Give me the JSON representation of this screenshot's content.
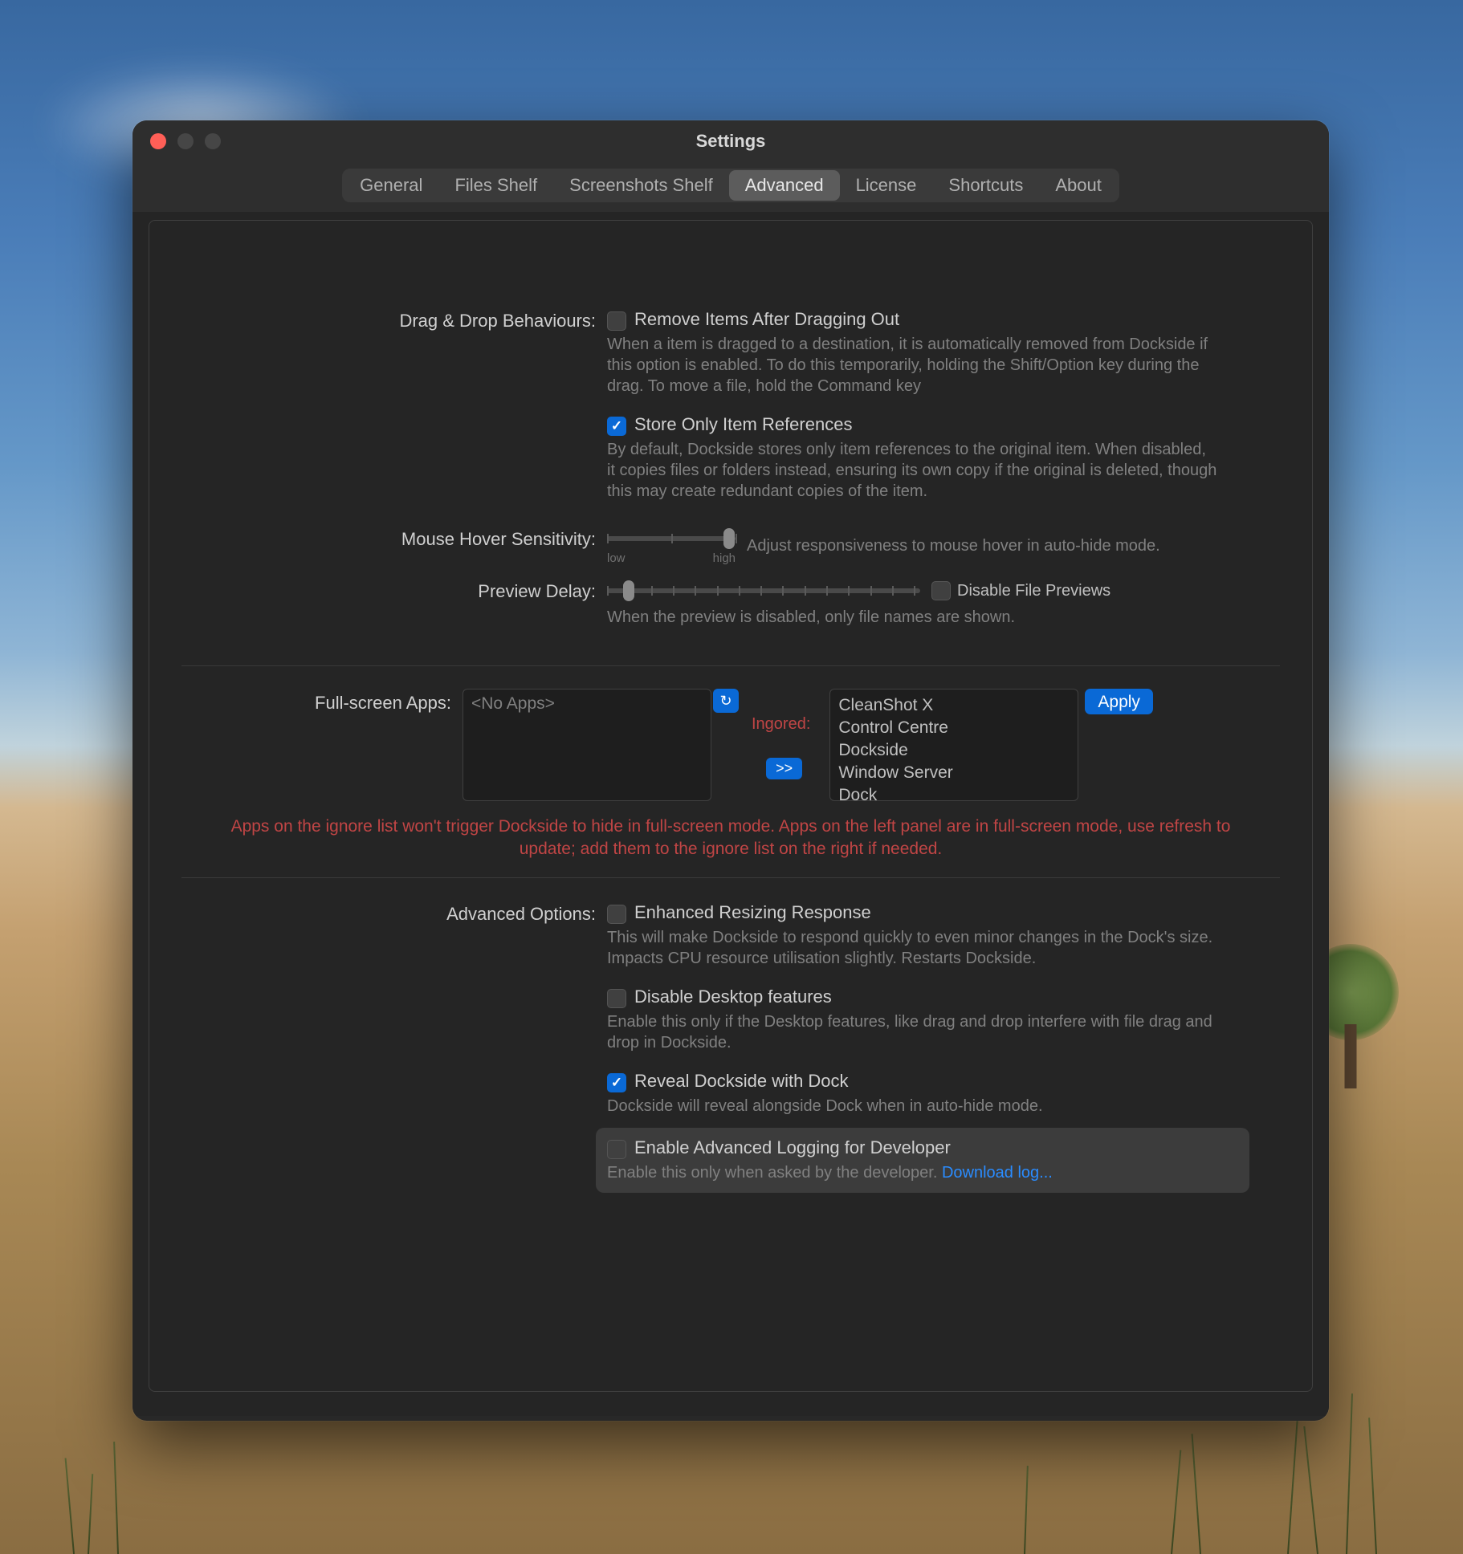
{
  "window": {
    "title": "Settings"
  },
  "tabs": {
    "general": "General",
    "files_shelf": "Files Shelf",
    "screenshots_shelf": "Screenshots Shelf",
    "advanced": "Advanced",
    "license": "License",
    "shortcuts": "Shortcuts",
    "about": "About"
  },
  "drag_drop": {
    "label": "Drag & Drop Behaviours:",
    "remove_items": {
      "label": "Remove Items After Dragging Out",
      "desc": "When a item is dragged to a destination, it is automatically removed from Dockside if this option is enabled. To do this temporarily, holding the Shift/Option key during the drag. To move a file, hold the Command key",
      "checked": false
    },
    "store_refs": {
      "label": "Store Only Item References",
      "desc": "By default, Dockside stores only item references to the original item. When disabled, it copies files or folders instead, ensuring its own copy if the original is deleted, though this may create redundant copies of the item.",
      "checked": true
    }
  },
  "hover": {
    "label": "Mouse Hover Sensitivity:",
    "desc": "Adjust responsiveness to mouse hover in auto-hide mode.",
    "low": "low",
    "high": "high"
  },
  "preview": {
    "label": "Preview Delay:",
    "disable_label": "Disable File Previews",
    "disable_checked": false,
    "desc": "When the preview is disabled, only file names are shown."
  },
  "fullscreen": {
    "label": "Full-screen Apps:",
    "no_apps": "<No Apps>",
    "ignored_label": "Ingored:",
    "ignored": [
      "CleanShot X",
      "Control Centre",
      "Dockside",
      "Window Server",
      "Dock"
    ],
    "apply": "Apply",
    "move": ">>",
    "desc": "Apps on the ignore list won't trigger Dockside to hide in full-screen mode. Apps on the left panel are in full-screen mode, use refresh to update; add them to the ignore list on the right if needed."
  },
  "advanced": {
    "label": "Advanced Options:",
    "enhanced_resize": {
      "label": "Enhanced Resizing Response",
      "desc": "This will make Dockside to respond quickly to even minor changes in the Dock's size. Impacts CPU resource utilisation slightly. Restarts Dockside.",
      "checked": false
    },
    "disable_desktop": {
      "label": "Disable Desktop features",
      "desc": "Enable this only if the Desktop features, like drag and drop interfere with file drag and drop in Dockside.",
      "checked": false
    },
    "reveal_dock": {
      "label": "Reveal Dockside with Dock",
      "desc": "Dockside will reveal alongside Dock when in auto-hide mode.",
      "checked": true
    },
    "logging": {
      "label": "Enable Advanced Logging for Developer",
      "desc": "Enable this only when asked by the developer. ",
      "link": "Download log...",
      "checked": false
    }
  }
}
